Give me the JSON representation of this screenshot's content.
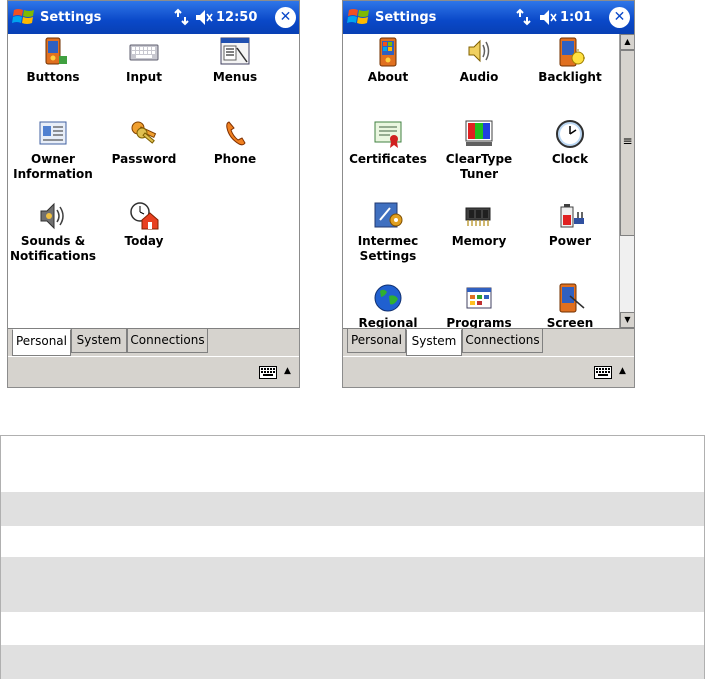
{
  "left_screen": {
    "title": "Settings",
    "time": "12:50",
    "close_label": "⊗",
    "items": [
      {
        "label": "Buttons",
        "icon": "buttons-icon"
      },
      {
        "label": "Input",
        "icon": "keyboard-icon"
      },
      {
        "label": "Menus",
        "icon": "menus-icon"
      },
      {
        "label": "Owner Information",
        "icon": "owner-card-icon"
      },
      {
        "label": "Password",
        "icon": "keys-icon"
      },
      {
        "label": "Phone",
        "icon": "phone-icon"
      },
      {
        "label": "Sounds & Notifications",
        "icon": "speaker-icon"
      },
      {
        "label": "Today",
        "icon": "today-clock-icon"
      }
    ],
    "tabs": [
      {
        "label": "Personal",
        "active": true
      },
      {
        "label": "System",
        "active": false
      },
      {
        "label": "Connections",
        "active": false
      }
    ]
  },
  "right_screen": {
    "title": "Settings",
    "time": "1:01",
    "close_label": "⊗",
    "items": [
      {
        "label": "About",
        "icon": "about-device-icon"
      },
      {
        "label": "Audio",
        "icon": "audio-icon"
      },
      {
        "label": "Backlight",
        "icon": "backlight-icon"
      },
      {
        "label": "Certificates",
        "icon": "certificate-icon"
      },
      {
        "label": "ClearType Tuner",
        "icon": "cleartype-icon"
      },
      {
        "label": "Clock",
        "icon": "clock-icon"
      },
      {
        "label": "Intermec Settings",
        "icon": "intermec-gear-icon"
      },
      {
        "label": "Memory",
        "icon": "memory-chip-icon"
      },
      {
        "label": "Power",
        "icon": "battery-icon"
      },
      {
        "label": "Regional",
        "icon": "globe-icon"
      },
      {
        "label": "Programs",
        "icon": "programs-icon"
      },
      {
        "label": "Screen",
        "icon": "screen-icon"
      }
    ],
    "tabs": [
      {
        "label": "Personal",
        "active": false
      },
      {
        "label": "System",
        "active": true
      },
      {
        "label": "Connections",
        "active": false
      }
    ]
  },
  "colors": {
    "titlebar": "#0a48c8",
    "tabstrip": "#d6d3ce",
    "table_shade": "#e0e0e0"
  }
}
